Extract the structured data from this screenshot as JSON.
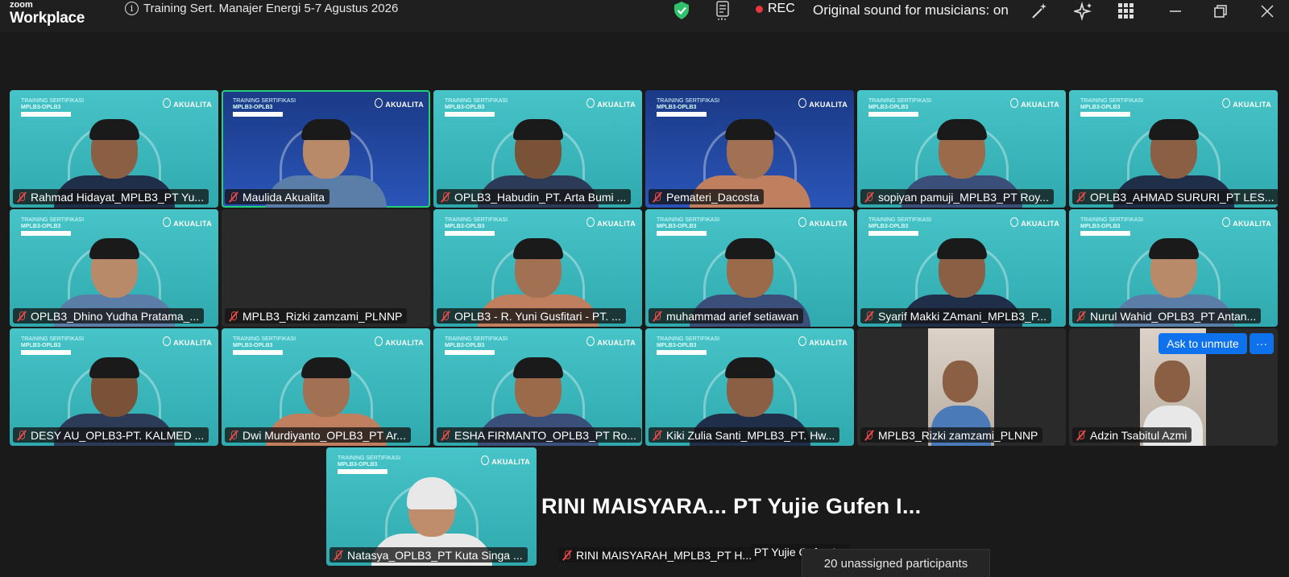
{
  "app": {
    "brand_small": "zoom",
    "brand_large": "Workplace"
  },
  "meeting": {
    "title": "Training Sert. Manajer Energi 5-7 Agustus 2026"
  },
  "status": {
    "rec": "REC",
    "original_sound": "Original sound for musicians: on"
  },
  "tiles": [
    {
      "name": "Rahmad Hidayat_MPLB3_PT Yu...",
      "style": "bg"
    },
    {
      "name": "Maulida Akualita",
      "style": "navy"
    },
    {
      "name": "OPLB3_Habudin_PT. Arta Bumi ...",
      "style": "bg"
    },
    {
      "name": "Pemateri_Dacosta",
      "style": "navy"
    },
    {
      "name": "sopiyan pamuji_MPLB3_PT Roy...",
      "style": "bg"
    },
    {
      "name": "OPLB3_AHMAD SURURI_PT LES...",
      "style": "bg"
    },
    {
      "name": "OPLB3_Dhino Yudha Pratama_...",
      "style": "bg"
    },
    {
      "name": "MPLB3_Rizki zamzami_PLNNP",
      "style": "dark"
    },
    {
      "name": "OPLB3 - R. Yuni Gusfitari - PT. ...",
      "style": "bg"
    },
    {
      "name": "muhammad arief setiawan",
      "style": "bg"
    },
    {
      "name": "Syarif Makki ZAmani_MPLB3_P...",
      "style": "bg"
    },
    {
      "name": "Nurul Wahid_OPLB3_PT Antan...",
      "style": "bg"
    },
    {
      "name": "DESY AU_OPLB3-PT. KALMED ...",
      "style": "bg"
    },
    {
      "name": "Dwi Murdiyanto_OPLB3_PT Ar...",
      "style": "bg"
    },
    {
      "name": "ESHA FIRMANTO_OPLB3_PT Ro...",
      "style": "bg"
    },
    {
      "name": "Kiki Zulia Santi_MPLB3_PT. Hw...",
      "style": "bg"
    },
    {
      "name": "MPLB3_Rizki zamzami_PLNNP",
      "style": "dark"
    },
    {
      "name": "Adzin Tsabitul Azmi",
      "style": "dark"
    }
  ],
  "bottom": {
    "tile1_name": "Natasya_OPLB3_PT Kuta Singa ...",
    "tile2_name": "RINI MAISYARAH_MPLB3_PT H...",
    "tile3_name": "PT Yujie Gufen I...",
    "big_name": "RINI  MAISYARA...  PT Yujie Gufen I...",
    "unassigned": "20 unassigned participants"
  },
  "controls": {
    "ask_to_unmute": "Ask to unmute",
    "more_label": "···"
  },
  "tile_brand": "AKUALITA",
  "tile_banner": "TRAINING SERTIFIKASI",
  "tile_banner_sub": "MPLB3-OPLB3",
  "colors": {
    "accent": "#0e72ed",
    "rec": "#e8383d",
    "muted_mic": "#e54a4a",
    "active_speaker": "#24d07a",
    "tile_teal": "#3bb8bc"
  }
}
